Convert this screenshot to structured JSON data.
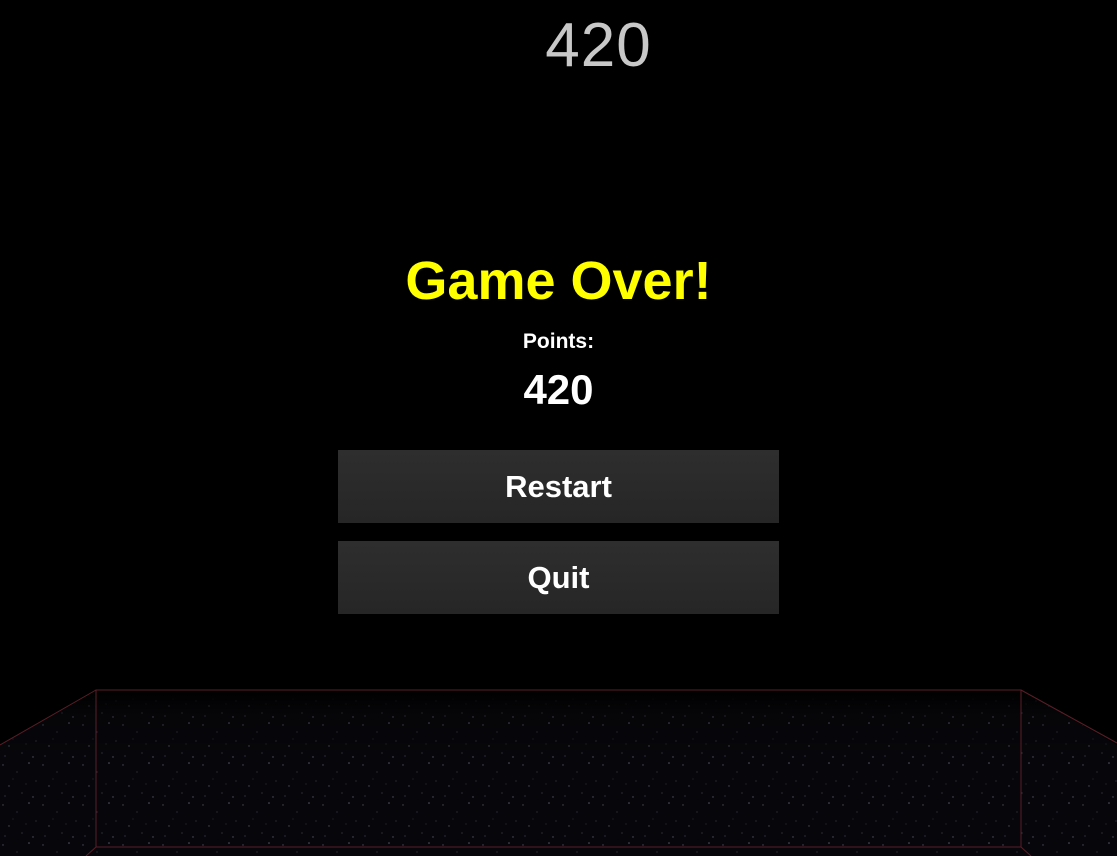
{
  "hud": {
    "score": "420"
  },
  "game_over": {
    "title": "Game Over!",
    "points_label": "Points:",
    "points_value": "420"
  },
  "buttons": {
    "restart_label": "Restart",
    "quit_label": "Quit"
  },
  "colors": {
    "title": "#ffff00",
    "score": "#c8c8c8",
    "button_bg": "#2a2a2a",
    "arena_outline": "#5a1e28"
  }
}
